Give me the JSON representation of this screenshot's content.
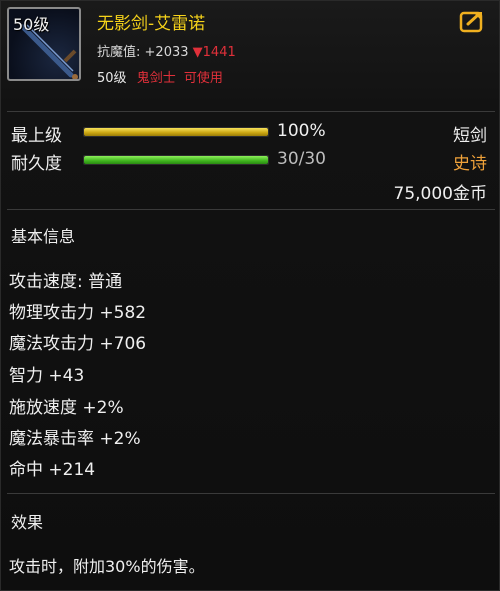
{
  "item": {
    "level_badge": "50级",
    "name": "无影剑-艾雷诺",
    "resist_label": "抗魔值:",
    "resist_value": "+2033",
    "resist_down": "▼1441",
    "req_level": "50级",
    "req_class": "鬼剑士",
    "req_usable": "可使用",
    "icon": "sword-icon"
  },
  "share": {
    "icon": "share-icon"
  },
  "stats": {
    "max_label": "最上级",
    "max_value": "100%",
    "max_fraction": 1.0,
    "dur_label": "耐久度",
    "dur_value": "30/30",
    "dur_fraction": 1.0,
    "weapon_type": "短剑",
    "rarity": "史诗",
    "price": "75,000金币"
  },
  "colors": {
    "name": "#f5d21a",
    "rarity": "#f0a23a",
    "warning": "#e0303a"
  },
  "basic": {
    "title": "基本信息",
    "attrs": [
      "攻击速度: 普通",
      "物理攻击力 +582",
      "魔法攻击力 +706",
      "智力 +43",
      "施放速度 +2%",
      "魔法暴击率 +2%",
      "命中 +214"
    ]
  },
  "effect": {
    "title": "效果",
    "text": "攻击时，附加30%的伤害。"
  }
}
